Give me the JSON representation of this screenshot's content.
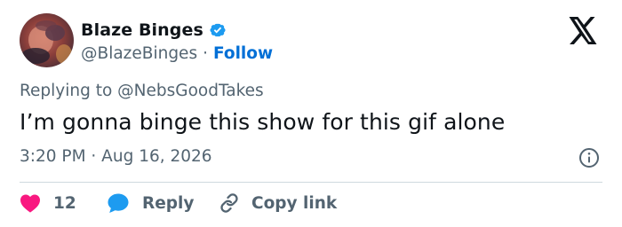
{
  "author": {
    "display_name": "Blaze Binges",
    "handle": "@BlazeBinges",
    "separator": "·",
    "follow_label": "Follow"
  },
  "reply_context": "Replying to @NebsGoodTakes",
  "tweet_text": "I’m gonna binge this show for this gif alone",
  "timestamp": "3:20 PM · Aug 16, 2026",
  "actions": {
    "like_count": "12",
    "reply_label": "Reply",
    "copy_link_label": "Copy link"
  },
  "colors": {
    "like": "#f91880",
    "reply": "#1d9bf0",
    "verified": "#1d9bf0",
    "follow": "#006fd6",
    "secondary_text": "#536471"
  },
  "icons": {
    "verified": "verified-badge-icon",
    "logo": "x-logo-icon",
    "info": "info-icon",
    "like": "heart-icon",
    "reply": "speech-bubble-icon",
    "copy_link": "link-icon"
  }
}
